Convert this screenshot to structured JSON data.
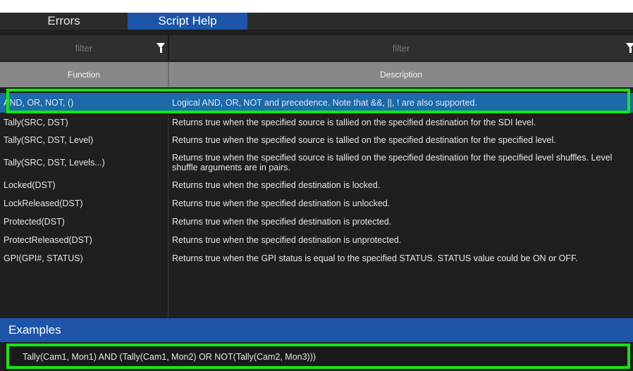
{
  "tabs": {
    "errors": "Errors",
    "script_help": "Script Help"
  },
  "filters": {
    "function_placeholder": "filter",
    "description_placeholder": "filter"
  },
  "headers": {
    "function": "Function",
    "description": "Description"
  },
  "rows": [
    {
      "function": "AND, OR, NOT, ()",
      "description": "Logical AND, OR, NOT and precedence. Note that &&, ||, ! are also supported."
    },
    {
      "function": "Tally(SRC, DST)",
      "description": "Returns true when the specified source is tallied on the specified destination for the SDI level."
    },
    {
      "function": "Tally(SRC, DST, Level)",
      "description": "Returns true when the specified source is tallied on the specified destination for the specified level."
    },
    {
      "function": "Tally(SRC, DST, Levels...)",
      "description": "Returns true when the specified source is tallied on the specified destination for the specified level shuffles. Level shuffle arguments are in pairs."
    },
    {
      "function": "Locked(DST)",
      "description": "Returns true when the specified destination is locked."
    },
    {
      "function": "LockReleased(DST)",
      "description": "Returns true when the specified destination is unlocked."
    },
    {
      "function": "Protected(DST)",
      "description": "Returns true when the specified destination is protected."
    },
    {
      "function": "ProtectReleased(DST)",
      "description": "Returns true when the specified destination is unprotected."
    },
    {
      "function": "GPI(GPI#, STATUS)",
      "description": "Returns true when the GPI status is equal to the specified STATUS. STATUS value could be ON or OFF."
    }
  ],
  "examples": {
    "title": "Examples",
    "text": "Tally(Cam1, Mon1) AND (Tally(Cam1, Mon2) OR NOT(Tally(Cam2, Mon3)))"
  },
  "colors": {
    "tab_active": "#1d55a8",
    "row_selected": "#1c6aa8",
    "highlight": "#12e712"
  }
}
